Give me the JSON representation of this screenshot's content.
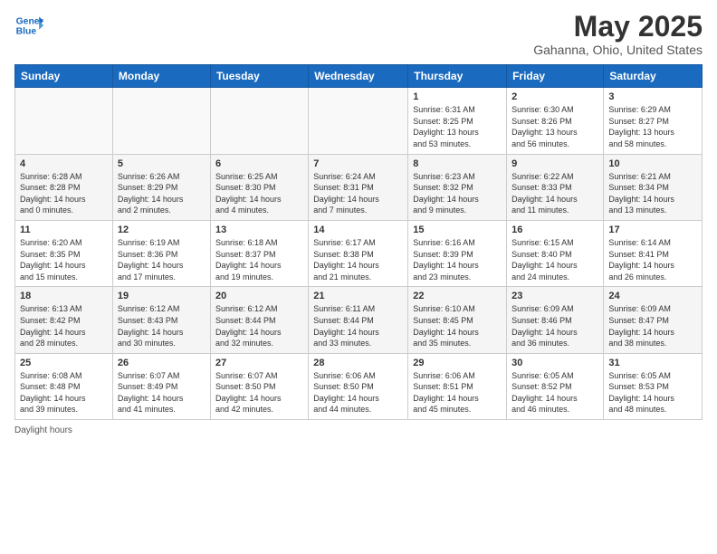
{
  "header": {
    "logo_line1": "General",
    "logo_line2": "Blue",
    "month_title": "May 2025",
    "location": "Gahanna, Ohio, United States"
  },
  "days_of_week": [
    "Sunday",
    "Monday",
    "Tuesday",
    "Wednesday",
    "Thursday",
    "Friday",
    "Saturday"
  ],
  "footer_text": "Daylight hours",
  "weeks": [
    [
      {
        "num": "",
        "info": ""
      },
      {
        "num": "",
        "info": ""
      },
      {
        "num": "",
        "info": ""
      },
      {
        "num": "",
        "info": ""
      },
      {
        "num": "1",
        "info": "Sunrise: 6:31 AM\nSunset: 8:25 PM\nDaylight: 13 hours\nand 53 minutes."
      },
      {
        "num": "2",
        "info": "Sunrise: 6:30 AM\nSunset: 8:26 PM\nDaylight: 13 hours\nand 56 minutes."
      },
      {
        "num": "3",
        "info": "Sunrise: 6:29 AM\nSunset: 8:27 PM\nDaylight: 13 hours\nand 58 minutes."
      }
    ],
    [
      {
        "num": "4",
        "info": "Sunrise: 6:28 AM\nSunset: 8:28 PM\nDaylight: 14 hours\nand 0 minutes."
      },
      {
        "num": "5",
        "info": "Sunrise: 6:26 AM\nSunset: 8:29 PM\nDaylight: 14 hours\nand 2 minutes."
      },
      {
        "num": "6",
        "info": "Sunrise: 6:25 AM\nSunset: 8:30 PM\nDaylight: 14 hours\nand 4 minutes."
      },
      {
        "num": "7",
        "info": "Sunrise: 6:24 AM\nSunset: 8:31 PM\nDaylight: 14 hours\nand 7 minutes."
      },
      {
        "num": "8",
        "info": "Sunrise: 6:23 AM\nSunset: 8:32 PM\nDaylight: 14 hours\nand 9 minutes."
      },
      {
        "num": "9",
        "info": "Sunrise: 6:22 AM\nSunset: 8:33 PM\nDaylight: 14 hours\nand 11 minutes."
      },
      {
        "num": "10",
        "info": "Sunrise: 6:21 AM\nSunset: 8:34 PM\nDaylight: 14 hours\nand 13 minutes."
      }
    ],
    [
      {
        "num": "11",
        "info": "Sunrise: 6:20 AM\nSunset: 8:35 PM\nDaylight: 14 hours\nand 15 minutes."
      },
      {
        "num": "12",
        "info": "Sunrise: 6:19 AM\nSunset: 8:36 PM\nDaylight: 14 hours\nand 17 minutes."
      },
      {
        "num": "13",
        "info": "Sunrise: 6:18 AM\nSunset: 8:37 PM\nDaylight: 14 hours\nand 19 minutes."
      },
      {
        "num": "14",
        "info": "Sunrise: 6:17 AM\nSunset: 8:38 PM\nDaylight: 14 hours\nand 21 minutes."
      },
      {
        "num": "15",
        "info": "Sunrise: 6:16 AM\nSunset: 8:39 PM\nDaylight: 14 hours\nand 23 minutes."
      },
      {
        "num": "16",
        "info": "Sunrise: 6:15 AM\nSunset: 8:40 PM\nDaylight: 14 hours\nand 24 minutes."
      },
      {
        "num": "17",
        "info": "Sunrise: 6:14 AM\nSunset: 8:41 PM\nDaylight: 14 hours\nand 26 minutes."
      }
    ],
    [
      {
        "num": "18",
        "info": "Sunrise: 6:13 AM\nSunset: 8:42 PM\nDaylight: 14 hours\nand 28 minutes."
      },
      {
        "num": "19",
        "info": "Sunrise: 6:12 AM\nSunset: 8:43 PM\nDaylight: 14 hours\nand 30 minutes."
      },
      {
        "num": "20",
        "info": "Sunrise: 6:12 AM\nSunset: 8:44 PM\nDaylight: 14 hours\nand 32 minutes."
      },
      {
        "num": "21",
        "info": "Sunrise: 6:11 AM\nSunset: 8:44 PM\nDaylight: 14 hours\nand 33 minutes."
      },
      {
        "num": "22",
        "info": "Sunrise: 6:10 AM\nSunset: 8:45 PM\nDaylight: 14 hours\nand 35 minutes."
      },
      {
        "num": "23",
        "info": "Sunrise: 6:09 AM\nSunset: 8:46 PM\nDaylight: 14 hours\nand 36 minutes."
      },
      {
        "num": "24",
        "info": "Sunrise: 6:09 AM\nSunset: 8:47 PM\nDaylight: 14 hours\nand 38 minutes."
      }
    ],
    [
      {
        "num": "25",
        "info": "Sunrise: 6:08 AM\nSunset: 8:48 PM\nDaylight: 14 hours\nand 39 minutes."
      },
      {
        "num": "26",
        "info": "Sunrise: 6:07 AM\nSunset: 8:49 PM\nDaylight: 14 hours\nand 41 minutes."
      },
      {
        "num": "27",
        "info": "Sunrise: 6:07 AM\nSunset: 8:50 PM\nDaylight: 14 hours\nand 42 minutes."
      },
      {
        "num": "28",
        "info": "Sunrise: 6:06 AM\nSunset: 8:50 PM\nDaylight: 14 hours\nand 44 minutes."
      },
      {
        "num": "29",
        "info": "Sunrise: 6:06 AM\nSunset: 8:51 PM\nDaylight: 14 hours\nand 45 minutes."
      },
      {
        "num": "30",
        "info": "Sunrise: 6:05 AM\nSunset: 8:52 PM\nDaylight: 14 hours\nand 46 minutes."
      },
      {
        "num": "31",
        "info": "Sunrise: 6:05 AM\nSunset: 8:53 PM\nDaylight: 14 hours\nand 48 minutes."
      }
    ]
  ]
}
